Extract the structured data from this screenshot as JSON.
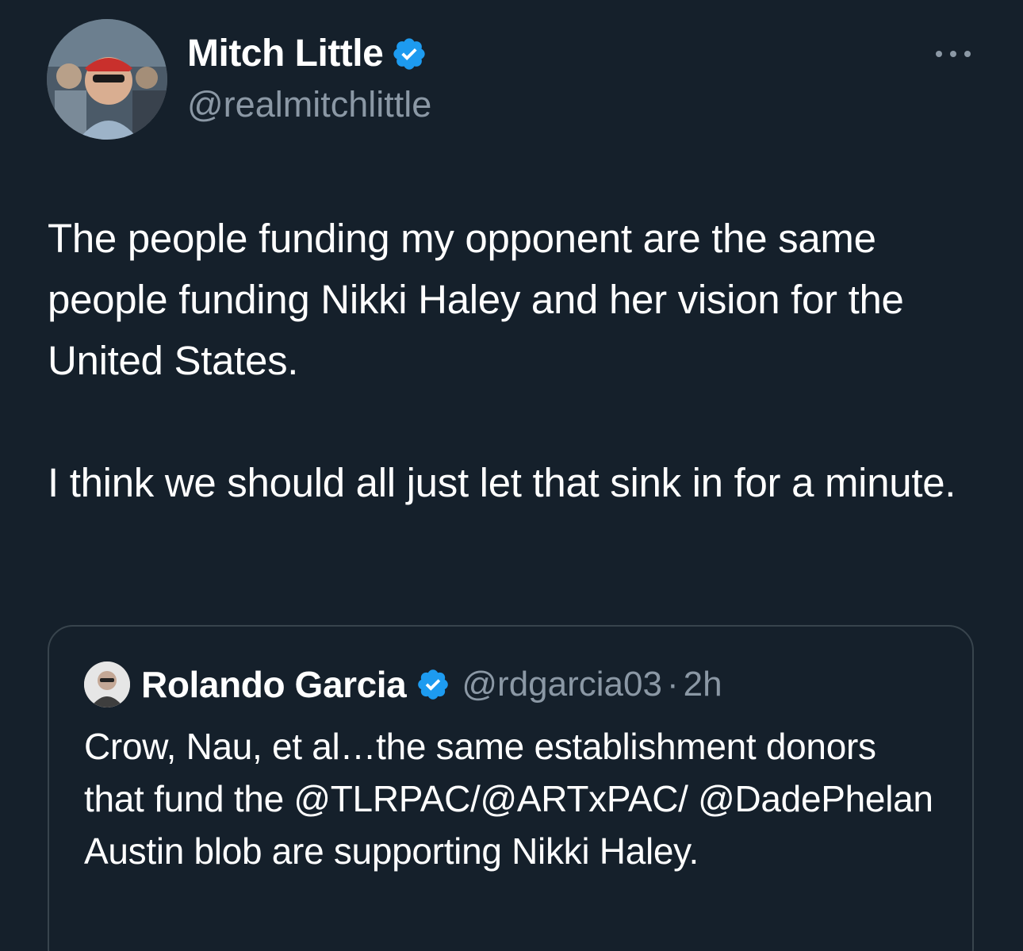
{
  "author": {
    "display_name": "Mitch Little",
    "handle": "@realmitchlittle",
    "avatar_icon": "profile-photo",
    "verified_icon": "verified-badge-icon"
  },
  "tweet": {
    "paragraphs": [
      "The people funding my opponent are the same people funding Nikki Haley and her vision for the United States.",
      "I think we should all just let that sink in for a minute."
    ]
  },
  "quoted_tweet": {
    "display_name": "Rolando Garcia",
    "handle": "@rdgarcia03",
    "separator": "·",
    "time": "2h",
    "text": "Crow, Nau, et al…the same establishment donors that fund the @TLRPAC/@ARTxPAC/ @DadePhelan Austin blob are supporting Nikki Haley."
  },
  "colors": {
    "background": "#15202b",
    "text_primary": "#ffffff",
    "text_secondary": "#8b98a5",
    "verified_blue": "#1d9bf0",
    "border": "#38444d"
  },
  "icons": {
    "more": "more-options-icon"
  }
}
